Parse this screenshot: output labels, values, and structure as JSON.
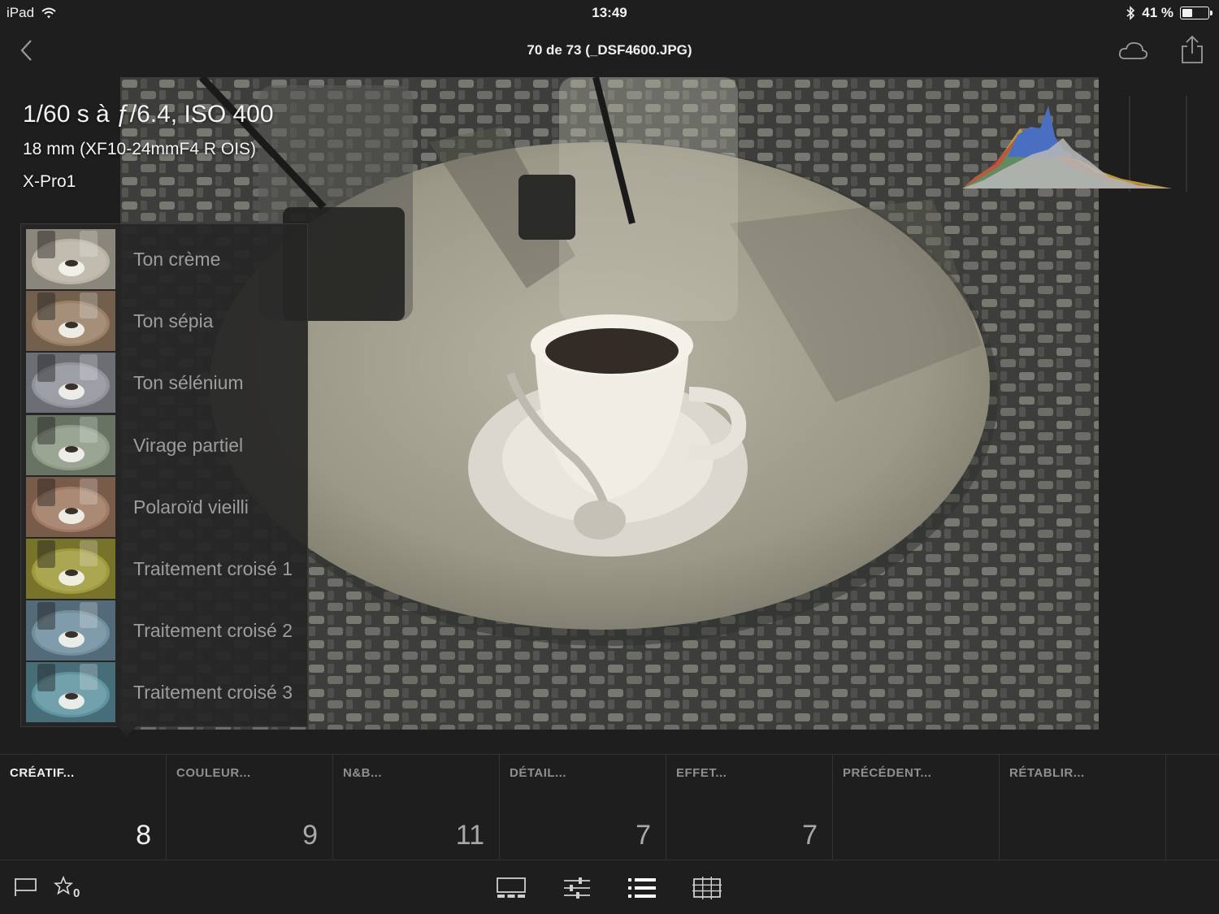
{
  "status_bar": {
    "device": "iPad",
    "time": "13:49",
    "battery": "41 %",
    "battery_level": 0.41
  },
  "nav": {
    "title": "70 de 73 (_DSF4600.JPG)"
  },
  "exif": {
    "exposure": "1/60 s à ƒ/6.4, ISO 400",
    "lens": "18 mm (XF10-24mmF4 R OIS)",
    "camera": "X-Pro1"
  },
  "presets": [
    {
      "label": "Ton crème",
      "tint": "#b9b3a4"
    },
    {
      "label": "Ton sépia",
      "tint": "#9a8066"
    },
    {
      "label": "Ton sélénium",
      "tint": "#8f939a"
    },
    {
      "label": "Virage partiel",
      "tint": "#8d9a85"
    },
    {
      "label": "Polaroïd vieilli",
      "tint": "#a07a62"
    },
    {
      "label": "Traitement croisé 1",
      "tint": "#9f9a3a"
    },
    {
      "label": "Traitement croisé 2",
      "tint": "#6f8fa0"
    },
    {
      "label": "Traitement croisé 3",
      "tint": "#5f93a0"
    }
  ],
  "tabs": [
    {
      "label": "CRÉATIF...",
      "count": "8"
    },
    {
      "label": "COULEUR...",
      "count": "9"
    },
    {
      "label": "N&B...",
      "count": "11"
    },
    {
      "label": "DÉTAIL...",
      "count": "7"
    },
    {
      "label": "EFFET...",
      "count": "7"
    },
    {
      "label": "PRÉCÉDENT...",
      "count": ""
    },
    {
      "label": "RÉTABLIR...",
      "count": ""
    }
  ],
  "toolbar": {
    "star_count": "0"
  },
  "colors": {
    "background": "#1e1e1e",
    "panel": "#262626",
    "text_inactive": "#9d9d9d",
    "text_active": "#f0f0f0"
  }
}
